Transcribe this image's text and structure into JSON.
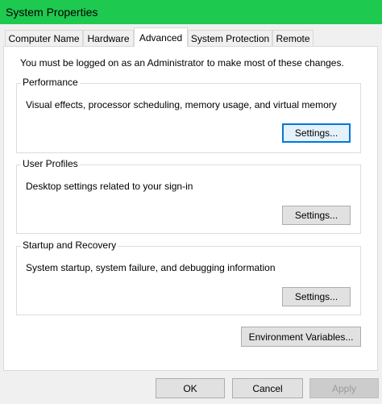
{
  "window": {
    "title": "System Properties"
  },
  "tabs": [
    {
      "label": "Computer Name",
      "active": false
    },
    {
      "label": "Hardware",
      "active": false
    },
    {
      "label": "Advanced",
      "active": true
    },
    {
      "label": "System Protection",
      "active": false
    },
    {
      "label": "Remote",
      "active": false
    }
  ],
  "advanced": {
    "admin_note": "You must be logged on as an Administrator to make most of these changes.",
    "performance": {
      "title": "Performance",
      "description": "Visual effects, processor scheduling, memory usage, and virtual memory",
      "button": "Settings..."
    },
    "user_profiles": {
      "title": "User Profiles",
      "description": "Desktop settings related to your sign-in",
      "button": "Settings..."
    },
    "startup_recovery": {
      "title": "Startup and Recovery",
      "description": "System startup, system failure, and debugging information",
      "button": "Settings..."
    },
    "env_button": "Environment Variables..."
  },
  "footer": {
    "ok": "OK",
    "cancel": "Cancel",
    "apply": "Apply"
  },
  "colors": {
    "titlebar": "#1ec94f",
    "focus": "#0078d7"
  }
}
